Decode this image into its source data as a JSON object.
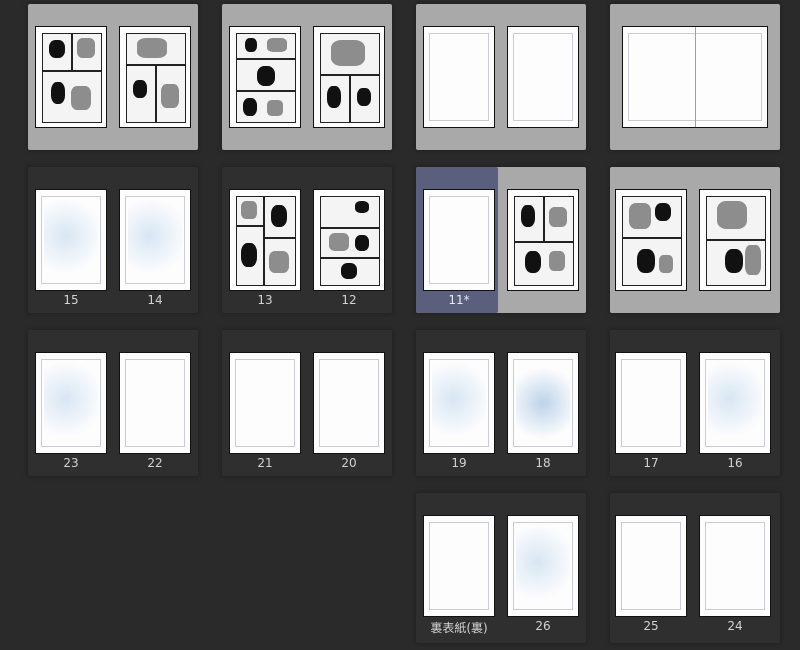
{
  "accent": {
    "selected": "#a9a9a9",
    "current": "#5a5f7d",
    "background": "#2a2a2a"
  },
  "pages": {
    "p15": "15",
    "p14": "14",
    "p13": "13",
    "p12": "12",
    "p11": "11*",
    "p23": "23",
    "p22": "22",
    "p21": "21",
    "p20": "20",
    "p19": "19",
    "p18": "18",
    "p17": "17",
    "p16": "16",
    "back_cover": "裏表紙(裏)",
    "p26": "26",
    "p25": "25",
    "p24": "24"
  }
}
